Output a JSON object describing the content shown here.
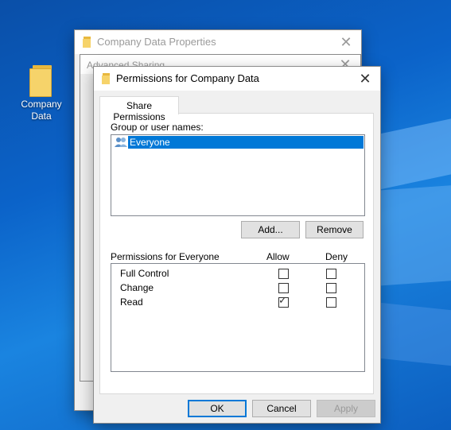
{
  "desktop": {
    "icon_label": "Company Data"
  },
  "bg_window": {
    "title": "Company Data Properties"
  },
  "adv_window": {
    "title": "Advanced Sharing"
  },
  "dialog": {
    "title": "Permissions for Company Data",
    "tab": "Share Permissions",
    "group_label": "Group or user names:",
    "users": [
      "Everyone"
    ],
    "add_label": "Add...",
    "remove_label": "Remove",
    "perm_header": "Permissions for Everyone",
    "allow_header": "Allow",
    "deny_header": "Deny",
    "permissions": [
      {
        "name": "Full Control",
        "allow": false,
        "deny": false
      },
      {
        "name": "Change",
        "allow": false,
        "deny": false
      },
      {
        "name": "Read",
        "allow": true,
        "deny": false
      }
    ],
    "ok_label": "OK",
    "cancel_label": "Cancel",
    "apply_label": "Apply"
  }
}
